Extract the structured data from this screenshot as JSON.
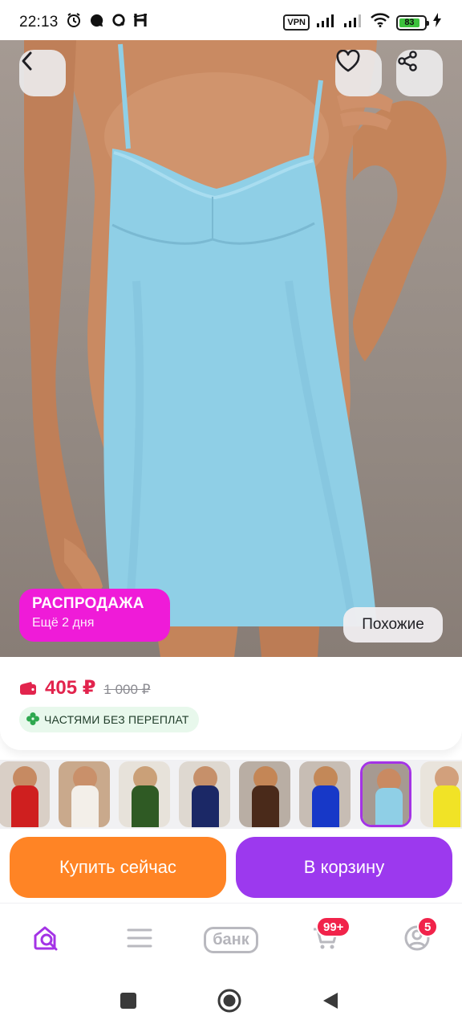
{
  "status_bar": {
    "time": "22:13",
    "vpn": "VPN",
    "battery": "83",
    "icons": [
      "alarm-icon",
      "chat-icon",
      "circle-app-icon",
      "h-app-icon",
      "signal-icon",
      "wifi-icon",
      "charging-icon"
    ]
  },
  "hero": {
    "back_icon": "chevron-left-icon",
    "favorite_icon": "heart-icon",
    "share_icon": "share-icon",
    "sale_title": "РАСПРОДАЖА",
    "sale_subtitle": "Ещё 2 дня",
    "similar_label": "Похожие",
    "colors": {
      "sale": "#ef1bd8",
      "dress": "#8fcfe6"
    }
  },
  "price": {
    "current": "405 ₽",
    "old": "1 000 ₽",
    "installments": "ЧАСТЯМИ БЕЗ ПЕРЕПЛАТ",
    "colors": {
      "current": "#e2244d",
      "installments_bg": "#e8f8ec"
    }
  },
  "thumbnails": {
    "variants": [
      "red",
      "white",
      "green",
      "navy",
      "brown",
      "blue",
      "light-blue",
      "yellow"
    ],
    "selected": "light-blue"
  },
  "actions": {
    "buy_now": "Купить сейчас",
    "add_to_cart": "В корзину",
    "colors": {
      "buy_now": "#ff8425",
      "add_to_cart": "#9c39ee"
    }
  },
  "bottom_nav": {
    "home_icon": "home-search-icon",
    "catalog_icon": "menu-icon",
    "bank_label": "банк",
    "cart_icon": "cart-icon",
    "cart_badge": "99+",
    "profile_icon": "profile-icon",
    "profile_badge": "5",
    "accent": "#a433e6"
  },
  "system_nav": [
    "recents-icon",
    "home-circle-icon",
    "back-triangle-icon"
  ]
}
